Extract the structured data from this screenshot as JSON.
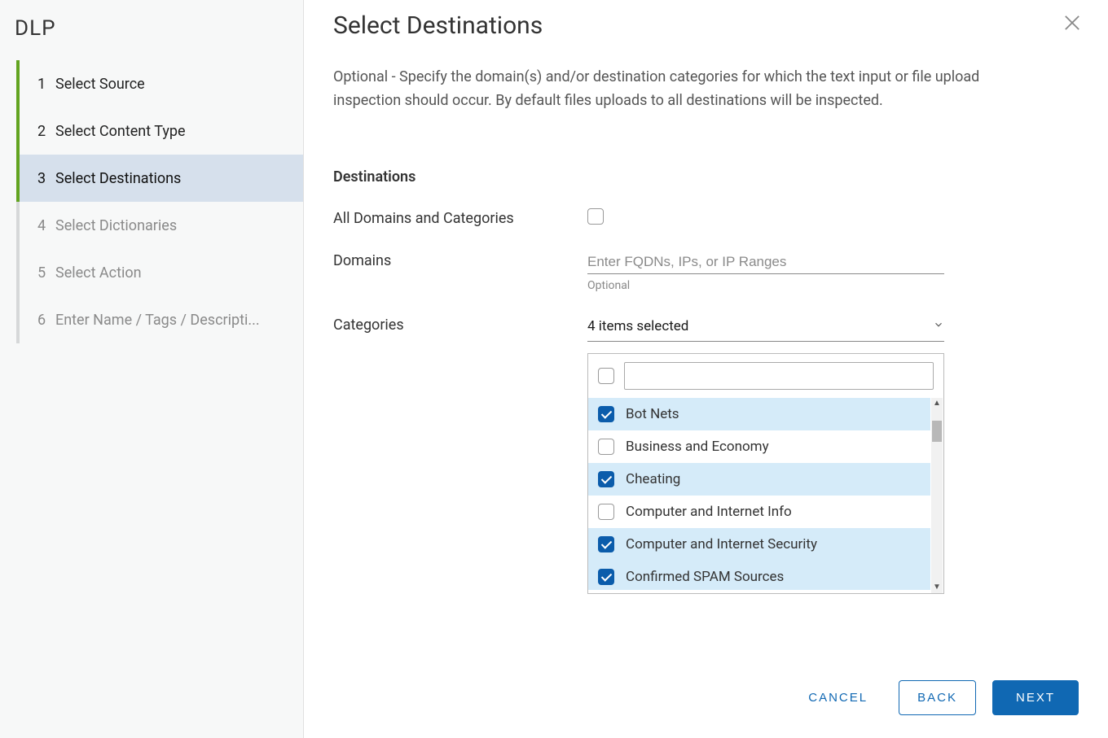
{
  "sidebar": {
    "title": "DLP",
    "steps": [
      {
        "num": "1",
        "label": "Select Source",
        "state": "done"
      },
      {
        "num": "2",
        "label": "Select Content Type",
        "state": "done"
      },
      {
        "num": "3",
        "label": "Select Destinations",
        "state": "current"
      },
      {
        "num": "4",
        "label": "Select Dictionaries",
        "state": "future"
      },
      {
        "num": "5",
        "label": "Select Action",
        "state": "future"
      },
      {
        "num": "6",
        "label": "Enter Name / Tags / Descripti...",
        "state": "future"
      }
    ]
  },
  "main": {
    "title": "Select Destinations",
    "description": "Optional - Specify the domain(s) and/or destination categories for which the text input or file upload inspection should occur. By default files uploads to all destinations will be inspected.",
    "section_header": "Destinations",
    "all_domains_label": "All Domains and Categories",
    "all_domains_checked": false,
    "domains_label": "Domains",
    "domains_placeholder": "Enter FQDNs, IPs, or IP Ranges",
    "domains_helper": "Optional",
    "categories_label": "Categories",
    "categories_summary": "4 items selected",
    "category_options": [
      {
        "label": "Bot Nets",
        "checked": true
      },
      {
        "label": "Business and Economy",
        "checked": false
      },
      {
        "label": "Cheating",
        "checked": true
      },
      {
        "label": "Computer and Internet Info",
        "checked": false
      },
      {
        "label": "Computer and Internet Security",
        "checked": true
      },
      {
        "label": "Confirmed SPAM Sources",
        "checked": true
      }
    ]
  },
  "footer": {
    "cancel": "CANCEL",
    "back": "BACK",
    "next": "NEXT"
  }
}
